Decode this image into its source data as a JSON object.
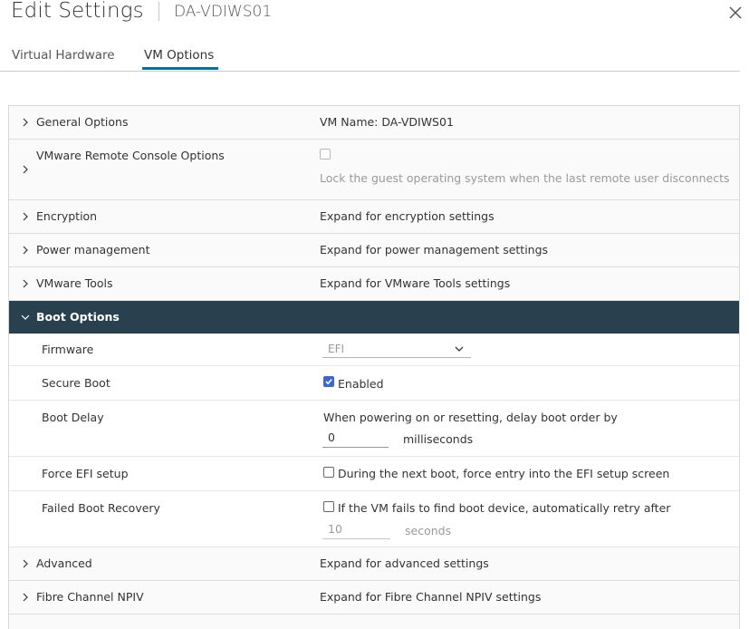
{
  "dialog": {
    "title": "Edit Settings",
    "vm_name": "DA-VDIWS01",
    "close_icon": "close-icon"
  },
  "tabs": [
    {
      "label": "Virtual Hardware",
      "active": false
    },
    {
      "label": "VM Options",
      "active": true
    }
  ],
  "colors": {
    "accent": "#0072a3",
    "header_bg": "#29414e",
    "checkbox_checked": "#3b66d6"
  },
  "sections": {
    "general": {
      "label": "General Options",
      "value": "VM Name: DA-VDIWS01"
    },
    "vmrc": {
      "label": "VMware Remote Console Options",
      "value": "Lock the guest operating system when the last remote user disconnects",
      "checked": false
    },
    "encryption": {
      "label": "Encryption",
      "value": "Expand for encryption settings"
    },
    "power": {
      "label": "Power management",
      "value": "Expand for power management settings"
    },
    "tools": {
      "label": "VMware Tools",
      "value": "Expand for VMware Tools settings"
    },
    "boot": {
      "label": "Boot Options",
      "firmware": {
        "label": "Firmware",
        "value": "EFI"
      },
      "secure_boot": {
        "label": "Secure Boot",
        "value": "Enabled",
        "checked": true
      },
      "boot_delay": {
        "label": "Boot Delay",
        "description": "When powering on or resetting, delay boot order by",
        "input_value": "0",
        "unit": "milliseconds"
      },
      "force_efi": {
        "label": "Force EFI setup",
        "value": "During the next boot, force entry into the EFI setup screen",
        "checked": false
      },
      "failed_recovery": {
        "label": "Failed Boot Recovery",
        "value": "If the VM fails to find boot device, automatically retry after",
        "checked": false,
        "input_value": "10",
        "unit": "seconds"
      }
    },
    "advanced": {
      "label": "Advanced",
      "value": "Expand for advanced settings"
    },
    "npiv": {
      "label": "Fibre Channel NPIV",
      "value": "Expand for Fibre Channel NPIV settings"
    }
  }
}
